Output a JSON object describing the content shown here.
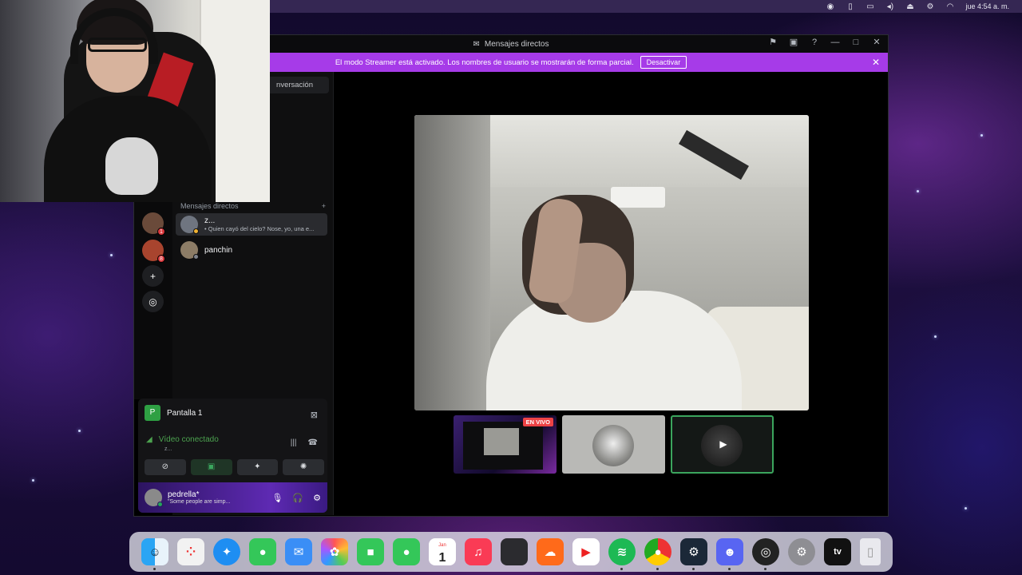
{
  "menubar": {
    "clock": "jue 4:54 a. m.",
    "icons": [
      "user-circle-icon",
      "phone-icon",
      "display-icon",
      "volume-icon",
      "eject-icon",
      "controls-icon",
      "wifi-icon",
      "search-icon"
    ]
  },
  "window": {
    "title": "Mensajes directos",
    "streamer_banner": {
      "text": "El modo Streamer está activado. Los nombres de usuario se mostrarán de forma parcial.",
      "button": "Desactivar"
    }
  },
  "sidebar": {
    "search_label": "nversación",
    "dm_header": "Mensajes directos",
    "dm_add": "+",
    "dms": [
      {
        "name": "z...",
        "sub": "• Quien cayó del cielo? Nose, yo, una e...",
        "active": true
      },
      {
        "name": "panchin",
        "sub": "",
        "active": false
      }
    ],
    "server_badges": [
      "1",
      "8"
    ]
  },
  "voice_panel": {
    "screen_label": "Pantalla 1",
    "screen_tile": "P",
    "status": "Vídeo conectado",
    "status_sub": "z...",
    "user": {
      "name": "pedrella*",
      "status": "\"Some people are simp..."
    }
  },
  "call": {
    "thumbnails": [
      {
        "type": "screen",
        "badge": "EN VIVO"
      },
      {
        "type": "avatar"
      },
      {
        "type": "camera",
        "selected": true
      }
    ]
  },
  "dock": {
    "calendar_month": "Jan",
    "calendar_day": "1",
    "apple_tv": "tv",
    "apps": [
      "finder",
      "launchpad",
      "safari",
      "messages",
      "mail",
      "photos",
      "facetime",
      "messages-2",
      "calendar",
      "music",
      "app-store",
      "soundcloud",
      "youtube",
      "spotify",
      "chrome",
      "steam",
      "discord",
      "obs",
      "settings",
      "apple-tv",
      "trash"
    ]
  },
  "colors": {
    "banner": "#a63be8",
    "connected": "#3ba55d",
    "live": "#ed4245"
  }
}
